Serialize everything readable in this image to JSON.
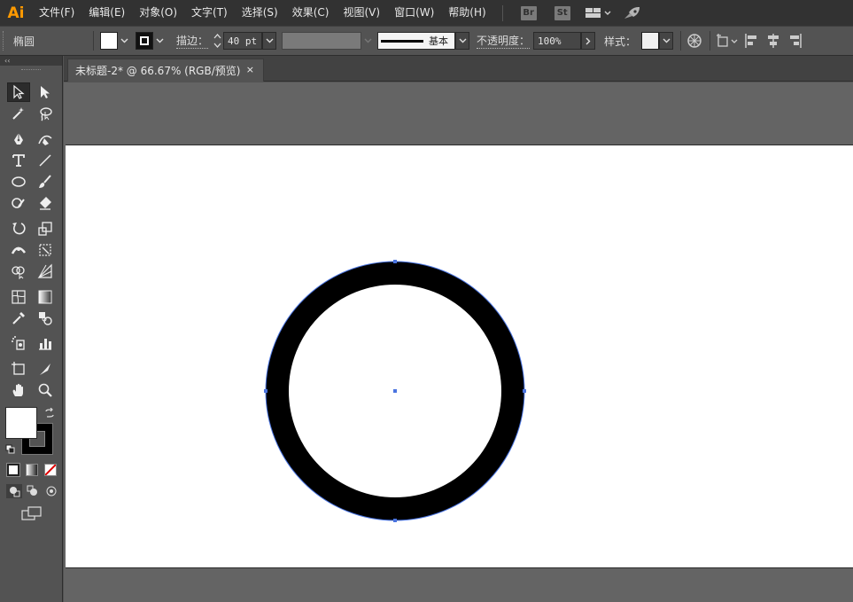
{
  "app": {
    "logo": "Ai"
  },
  "menu": {
    "items": [
      "文件(F)",
      "编辑(E)",
      "对象(O)",
      "文字(T)",
      "选择(S)",
      "效果(C)",
      "视图(V)",
      "窗口(W)",
      "帮助(H)"
    ],
    "bridge_label": "Br",
    "stock_label": "St"
  },
  "control_bar": {
    "object_type": "椭圆",
    "stroke_label": "描边：",
    "stroke_weight": "40 pt",
    "profile_label": "基本",
    "opacity_label": "不透明度：",
    "opacity_value": "100%",
    "style_label": "样式："
  },
  "tabs": [
    {
      "label": "未标题-2* @ 66.67% (RGB/预览)",
      "close": "×"
    }
  ],
  "colors": {
    "fill": "#ffffff",
    "stroke": "#000000",
    "selection": "#4a74e0",
    "accent": "#ff9a00"
  }
}
